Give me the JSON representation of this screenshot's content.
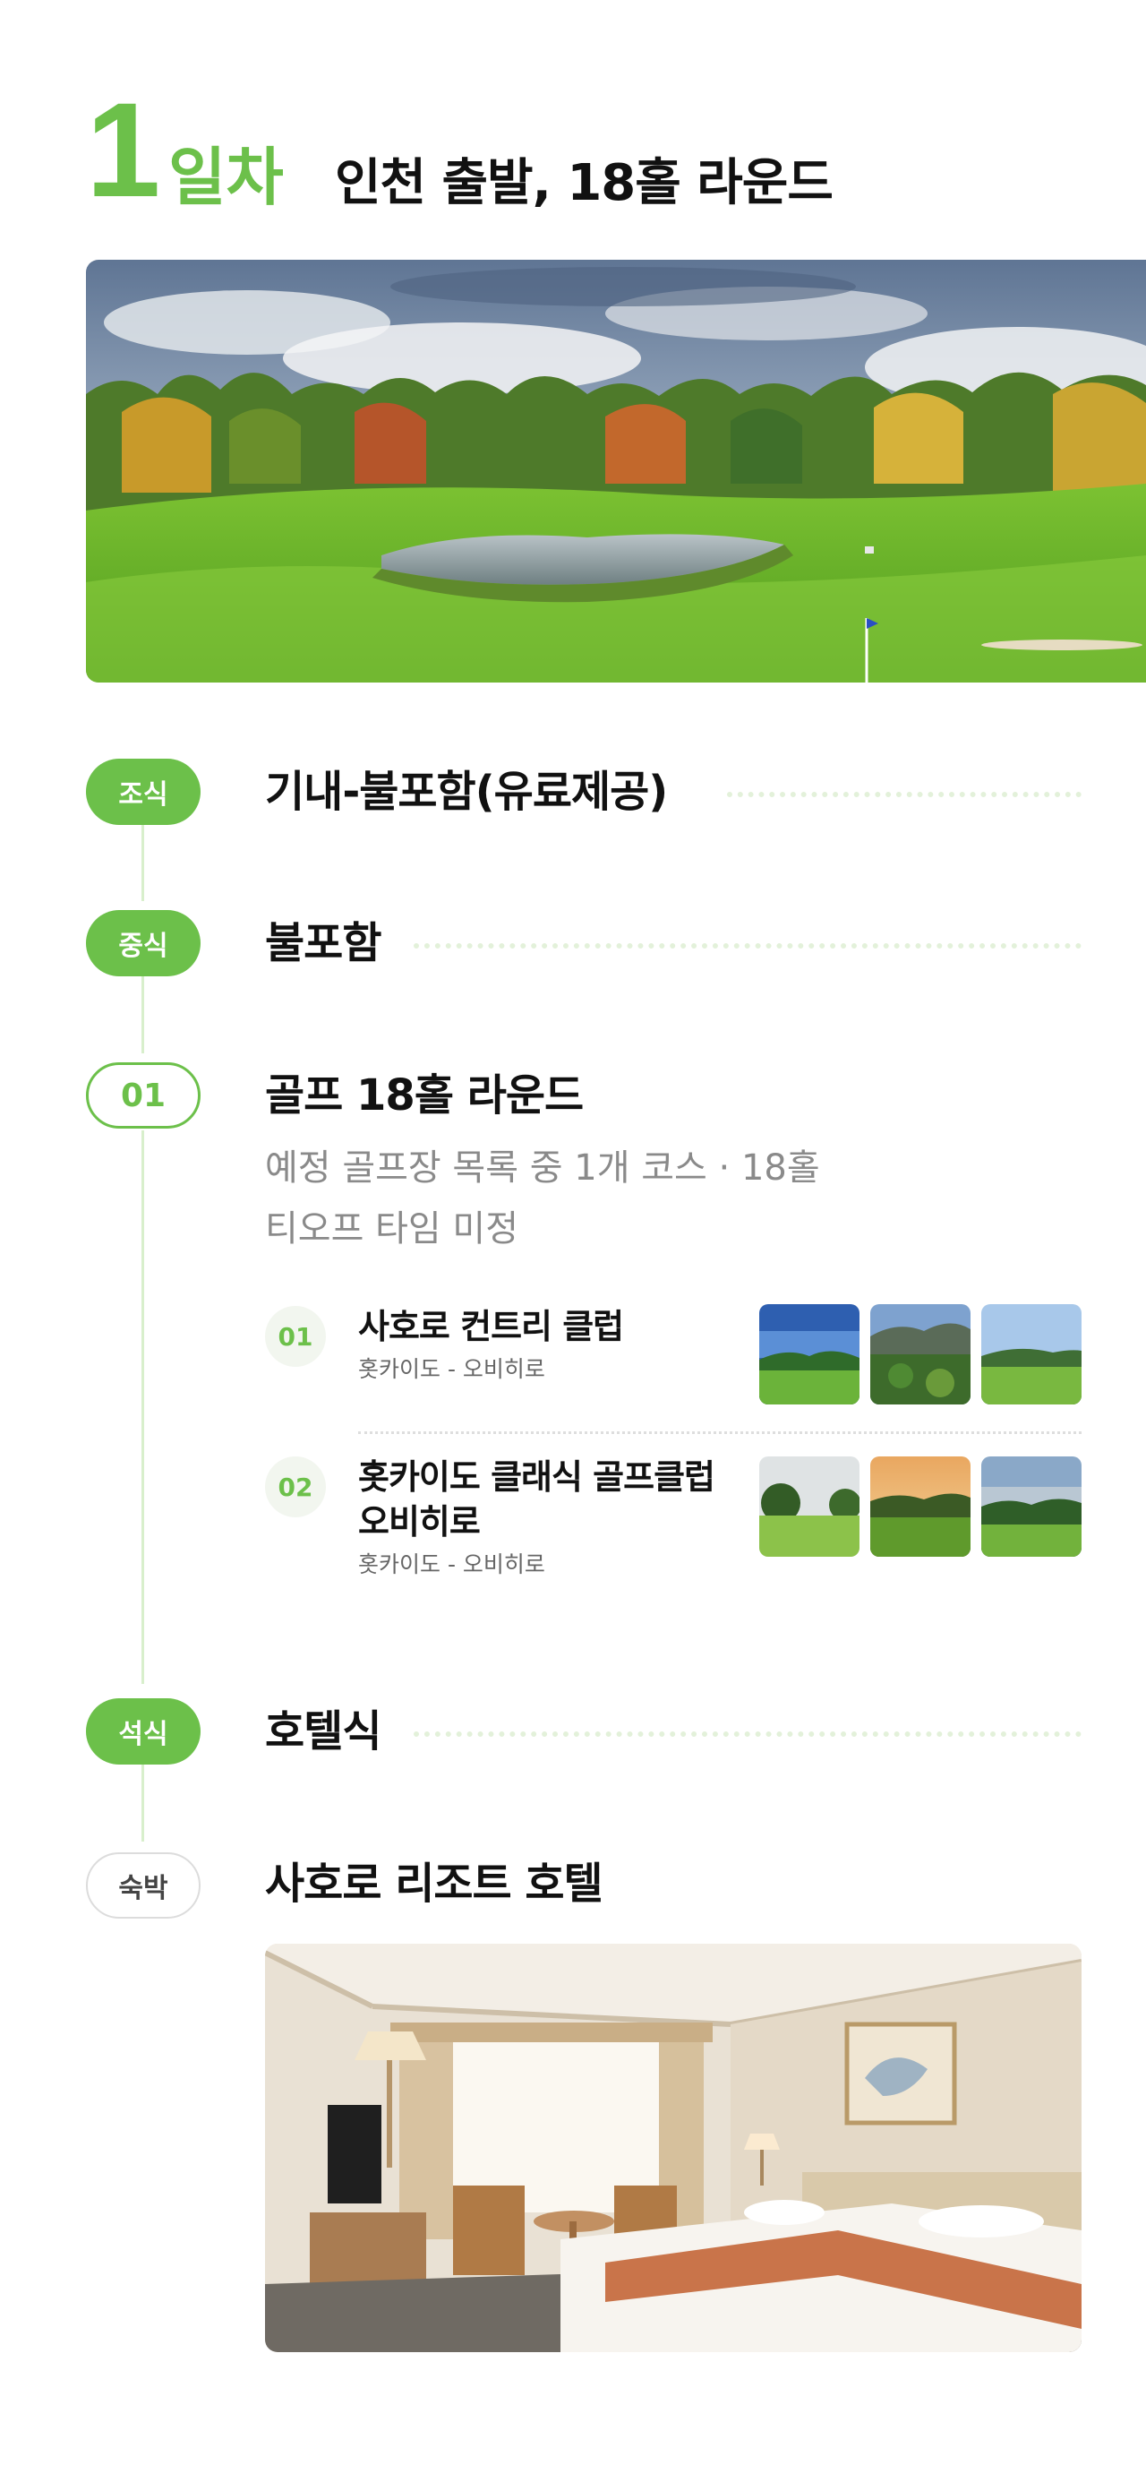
{
  "day": {
    "number": "1",
    "word": "일차",
    "title": "인천 출발, 18홀 라운드"
  },
  "timeline": {
    "breakfast": {
      "badge": "조식",
      "text": "기내-불포함(유료제공)"
    },
    "lunch": {
      "badge": "중식",
      "text": "불포함"
    },
    "activity": {
      "badge": "01",
      "title": "골프 18홀 라운드",
      "desc_line1": "예정 골프장 목록 중 1개 코스 · 18홀",
      "desc_line2": "티오프 타임 미정"
    },
    "dinner": {
      "badge": "석식",
      "text": "호텔식"
    },
    "lodging": {
      "badge": "숙박",
      "text": "사호로 리조트 호텔"
    }
  },
  "courses": [
    {
      "num": "01",
      "name_line1": "사호로 컨트리 클럽",
      "name_line2": "",
      "location": "홋카이도 - 오비히로"
    },
    {
      "num": "02",
      "name_line1": "홋카이도 클래식 골프클럽",
      "name_line2": "오비히로",
      "location": "홋카이도 - 오비히로"
    }
  ],
  "colors": {
    "accent": "#6cc04a",
    "accent_light": "#d8efcc",
    "text_muted": "#8a8a8a"
  }
}
